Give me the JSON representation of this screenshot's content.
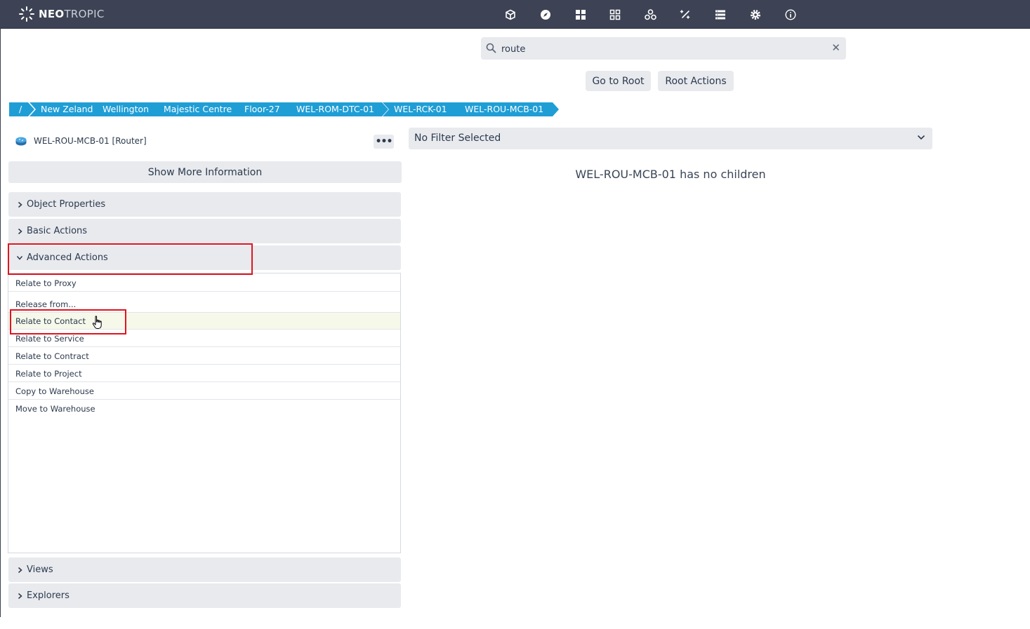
{
  "app": {
    "brand_bold": "NEO",
    "brand_light": "TROPIC",
    "accent_color": "#1f9ed6",
    "topbar_color": "#3d4354",
    "nav_icons": [
      "cube-icon",
      "compass-icon",
      "dashboard-icon",
      "apps-icon",
      "hub-icon",
      "magic-wand-icon",
      "list-icon",
      "gear-icon",
      "info-icon"
    ]
  },
  "search": {
    "value": "route",
    "clear_label": "✕"
  },
  "toolbar": {
    "go_to_root": "Go to Root",
    "root_actions": "Root Actions"
  },
  "breadcrumb": [
    {
      "label": "/"
    },
    {
      "label": "New Zeland"
    },
    {
      "label": "Wellington"
    },
    {
      "label": "Majestic Centre"
    },
    {
      "label": "Floor-27"
    },
    {
      "label": "WEL-ROM-DTC-01"
    },
    {
      "label": "WEL-RCK-01"
    },
    {
      "label": "WEL-ROU-MCB-01"
    }
  ],
  "object": {
    "label": "WEL-ROU-MCB-01 [Router]",
    "more_label": "•••",
    "icon": "router-icon"
  },
  "left": {
    "show_more": "Show More Information",
    "sections": {
      "object_properties": "Object Properties",
      "basic_actions": "Basic Actions",
      "advanced_actions": "Advanced Actions",
      "views": "Views",
      "explorers": "Explorers"
    },
    "advanced_items": [
      {
        "label": "Relate to Proxy"
      },
      {
        "label": "Release from..."
      },
      {
        "label": "Relate to Contact"
      },
      {
        "label": "Relate to Service"
      },
      {
        "label": "Relate to Contract"
      },
      {
        "label": "Relate to Project"
      },
      {
        "label": "Copy to Warehouse"
      },
      {
        "label": "Move to Warehouse"
      }
    ]
  },
  "right": {
    "filter_label": "No Filter Selected",
    "empty_message": "WEL-ROU-MCB-01 has no children"
  }
}
